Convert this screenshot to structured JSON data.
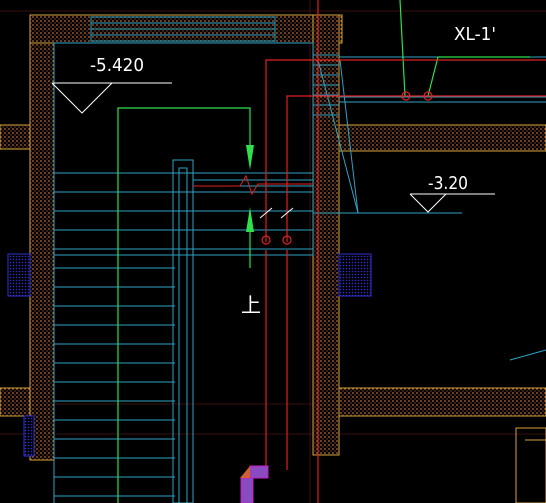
{
  "drawing": {
    "background": "#000000",
    "colors": {
      "wall_outline": "#d4a23a",
      "wall_hatch": "#b86a3a",
      "stair_lines": "#2fa3c4",
      "green_lines": "#2ee04a",
      "red_lines": "#e02020",
      "magenta_lines": "#c020c0",
      "blue_hatch": "#3030d0",
      "white_text": "#ffffff",
      "column_fill": "#8a4ac0"
    },
    "labels": {
      "level_top": "-5.420",
      "level_right": "-3.20",
      "riser_id": "XL-1'",
      "up_mark": "上"
    }
  }
}
